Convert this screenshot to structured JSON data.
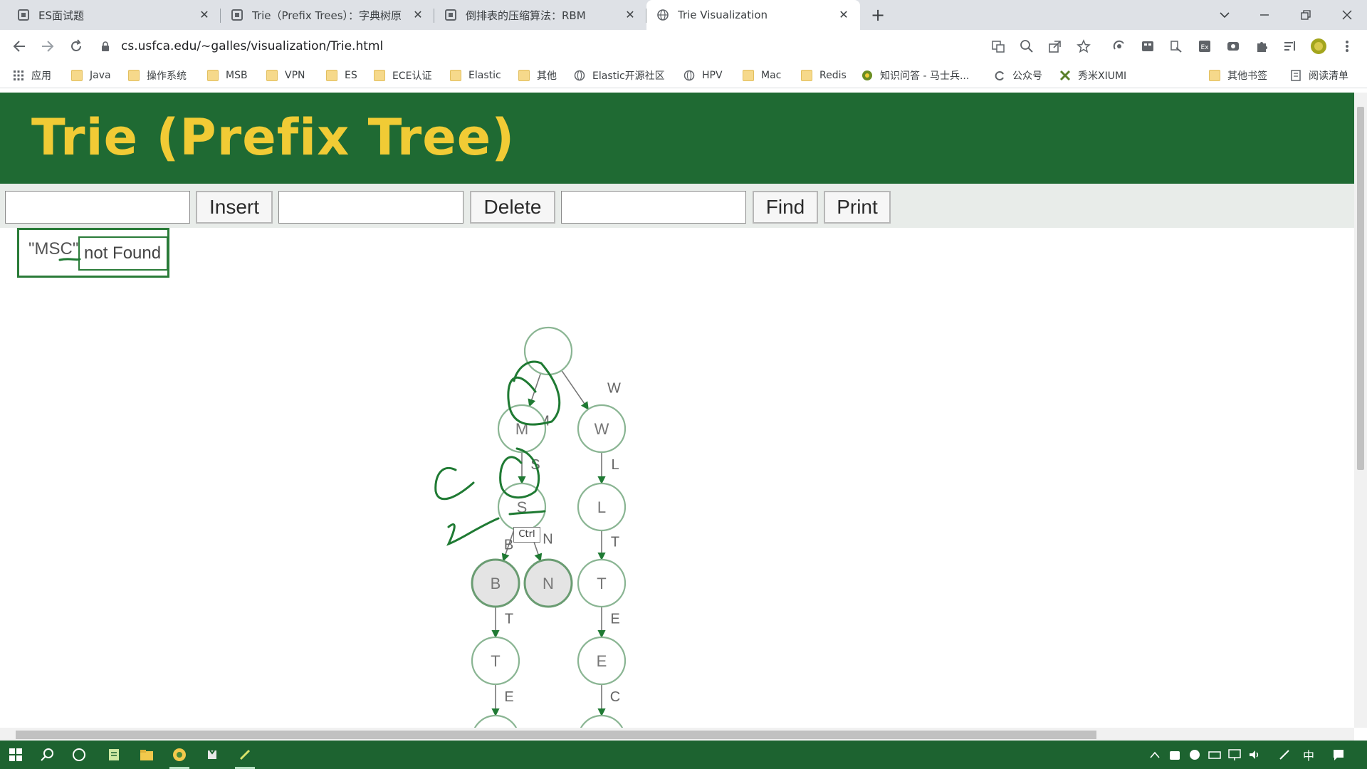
{
  "browser": {
    "tabs": [
      {
        "title": "ES面试题",
        "active": false
      },
      {
        "title": "Trie（Prefix Trees）：字典树原",
        "active": false
      },
      {
        "title": "倒排表的压缩算法：RBM",
        "active": false
      },
      {
        "title": "Trie Visualization",
        "active": true
      }
    ],
    "new_tab_label": "+",
    "url": "cs.usfca.edu/~galles/visualization/Trie.html",
    "bookmarks": [
      {
        "label": "应用",
        "icon": "apps-grid-icon"
      },
      {
        "label": "Java",
        "icon": "folder-icon"
      },
      {
        "label": "操作系统",
        "icon": "folder-icon"
      },
      {
        "label": "MSB",
        "icon": "folder-icon"
      },
      {
        "label": "VPN",
        "icon": "folder-icon"
      },
      {
        "label": "ES",
        "icon": "folder-icon"
      },
      {
        "label": "ECE认证",
        "icon": "folder-icon"
      },
      {
        "label": "Elastic",
        "icon": "folder-icon"
      },
      {
        "label": "其他",
        "icon": "folder-icon"
      },
      {
        "label": "Elastic开源社区",
        "icon": "globe-icon"
      },
      {
        "label": "HPV",
        "icon": "globe-icon"
      },
      {
        "label": "Mac",
        "icon": "folder-icon"
      },
      {
        "label": "Redis",
        "icon": "folder-icon"
      },
      {
        "label": "知识问答 - 马士兵...",
        "icon": "site-icon"
      },
      {
        "label": "公众号",
        "icon": "sync-icon"
      },
      {
        "label": "秀米XIUMI",
        "icon": "xiumi-icon"
      },
      {
        "label": "其他书签",
        "icon": "folder-icon"
      },
      {
        "label": "阅读清单",
        "icon": "reading-list-icon"
      }
    ]
  },
  "page": {
    "title": "Trie (Prefix Tree)",
    "buttons": {
      "insert": "Insert",
      "delete": "Delete",
      "find": "Find",
      "print": "Print"
    },
    "inputs": {
      "insert_value": "",
      "delete_value": "",
      "find_value": ""
    },
    "message": {
      "query": "\"MSC\"",
      "result": "not Found"
    },
    "tooltip": "Ctrl",
    "colors": {
      "header_bg": "#1f6a33",
      "title": "#f1cb35",
      "ink": "#1f7a33"
    }
  },
  "trie": {
    "nodes": [
      {
        "id": "root",
        "label": ""
      },
      {
        "id": "m",
        "label": "M"
      },
      {
        "id": "w",
        "label": "W"
      },
      {
        "id": "ms",
        "label": "S"
      },
      {
        "id": "wl",
        "label": "L"
      },
      {
        "id": "msb",
        "label": "B",
        "highlighted": true
      },
      {
        "id": "msn",
        "label": "N",
        "highlighted": true
      },
      {
        "id": "wlt",
        "label": "T"
      },
      {
        "id": "msbt",
        "label": "T"
      },
      {
        "id": "wlte",
        "label": "E"
      },
      {
        "id": "msbte",
        "label": ""
      },
      {
        "id": "wltec",
        "label": ""
      }
    ],
    "edges": [
      {
        "from": "root",
        "to": "m",
        "label": "M"
      },
      {
        "from": "root",
        "to": "w",
        "label": "W"
      },
      {
        "from": "m",
        "to": "ms",
        "label": "S"
      },
      {
        "from": "w",
        "to": "wl",
        "label": "L"
      },
      {
        "from": "ms",
        "to": "msb",
        "label": "B"
      },
      {
        "from": "ms",
        "to": "msn",
        "label": "N"
      },
      {
        "from": "wl",
        "to": "wlt",
        "label": "T"
      },
      {
        "from": "msb",
        "to": "msbt",
        "label": "T"
      },
      {
        "from": "wlt",
        "to": "wlte",
        "label": "E"
      },
      {
        "from": "msbt",
        "to": "msbte",
        "label": "E"
      },
      {
        "from": "wlte",
        "to": "wltec",
        "label": "C"
      }
    ]
  },
  "taskbar": {
    "ime_label": "中"
  }
}
